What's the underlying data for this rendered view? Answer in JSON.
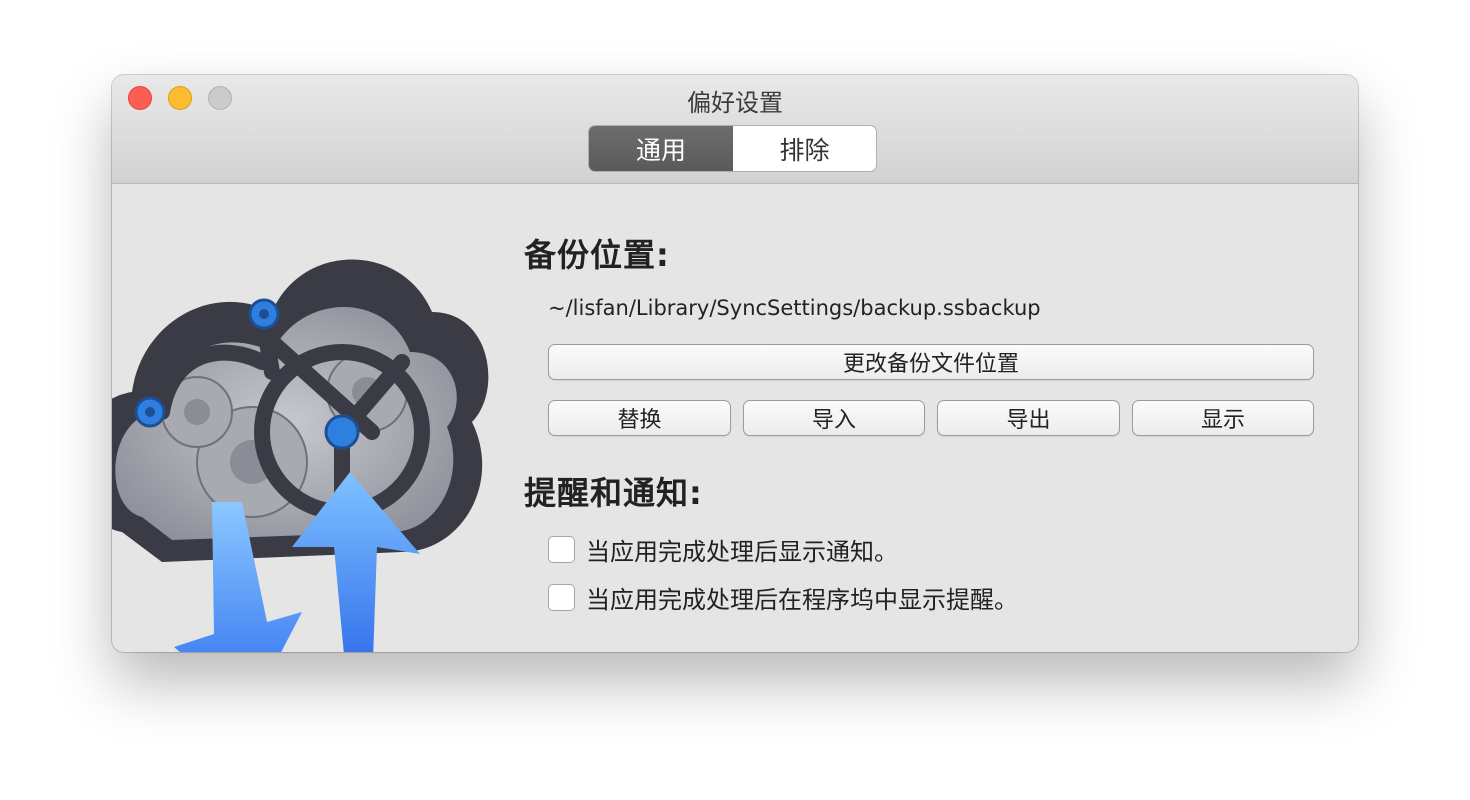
{
  "window": {
    "title": "偏好设置"
  },
  "tabs": [
    {
      "label": "通用",
      "selected": true
    },
    {
      "label": "排除",
      "selected": false
    }
  ],
  "backup": {
    "heading": "备份位置:",
    "path": "~/lisfan/Library/SyncSettings/backup.ssbackup",
    "change_location_label": "更改备份文件位置",
    "replace_label": "替换",
    "import_label": "导入",
    "export_label": "导出",
    "show_label": "显示"
  },
  "notifications": {
    "heading": "提醒和通知:",
    "options": [
      {
        "label": "当应用完成处理后显示通知。",
        "checked": false
      },
      {
        "label": "当应用完成处理后在程序坞中显示提醒。",
        "checked": false
      }
    ]
  },
  "icons": {
    "app_icon": "sync-settings-app-icon",
    "close": "close-icon",
    "minimize": "minimize-icon",
    "zoom": "zoom-icon"
  },
  "colors": {
    "close": "#fd5d55",
    "minimize": "#fdbb2e",
    "zoom": "#cbcbcb",
    "tab_selected": "#626262",
    "arrow_blue": "#3a86ff"
  }
}
